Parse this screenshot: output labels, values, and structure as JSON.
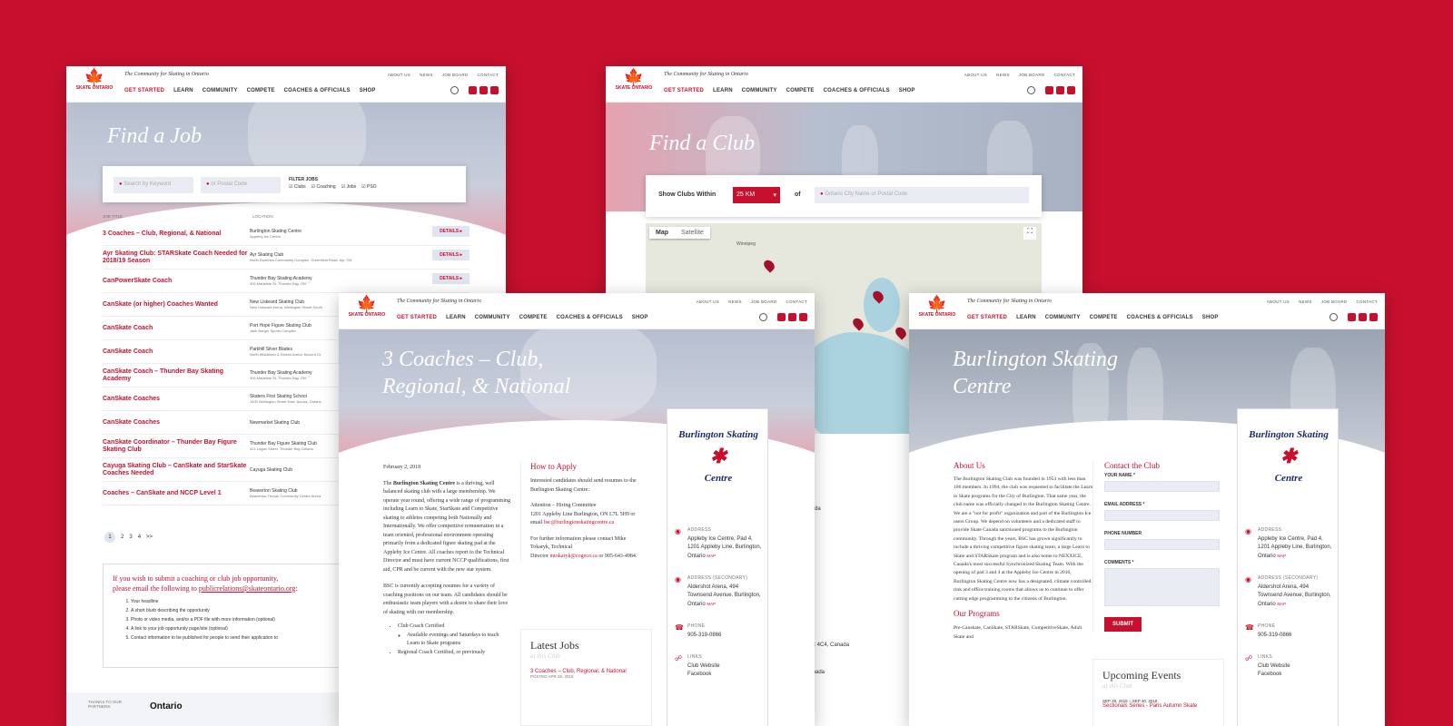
{
  "common": {
    "tagline": "The Community for Skating in Ontario",
    "logo_text": "SKATE ONTARIO",
    "logo_sub": "SKATE CANADA",
    "util_links": [
      "ABOUT US",
      "NEWS",
      "JOB BOARD",
      "CONTACT"
    ],
    "nav": [
      "GET STARTED",
      "LEARN",
      "COMMUNITY",
      "COMPETE",
      "COACHES & OFFICIALS",
      "SHOP"
    ]
  },
  "jobs_page": {
    "title": "Find a Job",
    "search_placeholder": "Search by Keyword",
    "postal_placeholder": "or Postal Code",
    "filter_label": "FILTER JOBS",
    "filters": [
      "Clubs",
      "Coaching",
      "Jobs",
      "PSO"
    ],
    "col_title": "JOB TITLE",
    "col_location": "LOCATION",
    "details_label": "DETAILS",
    "jobs": [
      {
        "title": "3 Coaches – Club, Regional, & National",
        "loc": "Burlington Skating Centre",
        "sub": "Appleby Ice Centre"
      },
      {
        "title": "Ayr Skating Club: STARSkate Coach Needed for 2018/19 Season",
        "loc": "Ayr Skating Club",
        "sub": "North Dumfries Community Complex, Greenfield Road, Ayr, ON"
      },
      {
        "title": "CanPowerSkate Coach",
        "loc": "Thunder Bay Skating Academy",
        "sub": "300 Madeline St, Thunder Bay, ON"
      },
      {
        "title": "CanSkate (or higher) Coaches Wanted",
        "loc": "New Liskeard Skating Club",
        "sub": "New Liskeard Arena, Wellington Street South"
      },
      {
        "title": "CanSkate Coach",
        "loc": "Port Hope Figure Skating Club",
        "sub": "Jack Burger Sports Complex"
      },
      {
        "title": "CanSkate Coach",
        "loc": "Parkhill Silver Blades",
        "sub": "North Middlesex & District Arena, Mccord Dr"
      },
      {
        "title": "CanSkate Coach – Thunder Bay Skating Academy",
        "loc": "Thunder Bay Skating Academy",
        "sub": "300 Madeline St, Thunder Bay, ON"
      },
      {
        "title": "CanSkate Coaches",
        "loc": "Skaters First Skating School",
        "sub": "1400 Wellington Street East, Aurora, Ontario"
      },
      {
        "title": "CanSkate Coaches",
        "loc": "Newmarket Skating Club",
        "sub": ""
      },
      {
        "title": "CanSkate Coordinator – Thunder Bay Figure Skating Club",
        "loc": "Thunder Bay Figure Skating Club",
        "sub": "421 Logan Street, Thunder Bay Ontario"
      },
      {
        "title": "Cayuga Skating Club – CanSkate and StarSkate Coaches Needed",
        "loc": "Cayuga Skating Club",
        "sub": ""
      },
      {
        "title": "Coaches – CanSkate and NCCP Level 1",
        "loc": "Beaverton Skating Club",
        "sub": "Beaverton-Thorah Community Centre Arena"
      }
    ],
    "pages": [
      "1",
      "2",
      "3",
      "4",
      ">>"
    ],
    "submit_heading_a": "If you wish to submit a coaching or club job opportunity,",
    "submit_heading_b": "please email the following to",
    "submit_email": "publicrelations@skateontario.org",
    "submit_list": [
      "Your headline",
      "A short blurb describing the opportunity",
      "Photo or video media, and/or a PDF file with more information (optional)",
      "A link to your job opportunity page/site (optional)",
      "Contact information to be published for people to send their application to"
    ],
    "partners_label": "THANKS TO OUR PARTNERS:",
    "partner_1": "Ontario"
  },
  "club_page": {
    "title": "Find a Club",
    "show_within": "Show Clubs Within",
    "distance": "25 KM",
    "of": "of",
    "location_placeholder": "Ontario City Name or Postal Code",
    "map_tab": "Map",
    "satellite_tab": "Satellite",
    "map_label": "Winnipeg",
    "list_fragments": [
      "anada",
      "L4C 4C4, Canada",
      "Canada"
    ]
  },
  "job_detail": {
    "title_1": "3 Coaches – Club,",
    "title_2": "Regional, & National",
    "date": "February 2, 2018",
    "body_a_pre": "The ",
    "body_a_bold": "Burlington Skating Centre",
    "body_a_rest": " is a thriving, well balanced skating club with a large membership. We operate year round, offering a wide range of programming including Learn to Skate, StarSkate and Competitive skating to athletes competing both Nationally and Internationally. We offer competitive remuneration in a team oriented, professional environment operating primarily from a dedicated figure skating pad at the Appleby Ice Centre. All coaches report to the Technical Director and must have current NCCP qualifications, first aid, CPR and be current with the new star system.",
    "body_b": "BSC is currently accepting resumes for a variety of coaching positions on our team. All candidates should be enthusiastic team players with a desire to share their love of skating with our membership.",
    "bullet_1": "Club Coach Certified",
    "sub_bullet_1": "Available evenings and Saturdays to teach Learn to Skate programs",
    "bullet_2": "Regional Coach Certified, or previously",
    "apply_heading": "How to Apply",
    "apply_1": "Interested candidates should send resumes to the Burlington Skating Centre:",
    "apply_2": "Attention – Hiring Committee",
    "apply_3": "1201 Appleby Line Burlington, ON L7L 5H9 or",
    "apply_4_pre": "email ",
    "apply_email": "bsc@burlingtonskatingcentre.ca",
    "apply_5": "For further information please contact Mike Tokaryk, Technical",
    "apply_6_pre": "Director ",
    "apply_email_2": "mtokaryk@cogeco.ca",
    "apply_6_post": " or 905-643-4984.",
    "latest_jobs": "Latest Jobs",
    "at_club": "at this Club",
    "latest_job_title": "3 Coaches – Club, Regional, & National",
    "latest_job_date": "POSTED APR 26, 2018"
  },
  "sidebar": {
    "club_name_1": "Burlington Skating",
    "club_name_2": "Centre",
    "address_label": "ADDRESS",
    "address": "Appleby Ice Centre, Pad 4, 1201 Appleby Line, Burlington, Ontario",
    "map_link": "MAP",
    "address2_label": "ADDRESS (SECONDARY)",
    "address2": "Aldershot Arena, 494 Townsend Avenue, Burlington, Ontario",
    "phone_label": "PHONE",
    "phone": "905-319-0866",
    "links_label": "LINKS",
    "link_1": "Club Website",
    "link_2": "Facebook"
  },
  "club_detail": {
    "title_1": "Burlington Skating",
    "title_2": "Centre",
    "about_heading": "About Us",
    "about_text": "The Burlington Skating Club was founded in 1953 with less than 100 members. In 1994, the club was requested to facilitate the Learn to Skate programs for the City of Burlington. That same year, the club name was officially changed to the Burlington Skating Centre. We are a \"not for profit\" organization and part of the Burlington Ice users Group. We depend on volunteers and a dedicated staff to provide Skate Canada sanctioned programs to the Burlington community. Through the years, BSC has grown significantly to include a thriving competitive figure skating team, a large Learn to Skate and STARSkate program and is also home to NEXXICE, Canada's most successful Synchronized Skating Team. With the opening of pad 3 and 4 at the Appleby Ice Centre in 2010, Burlington Skating Centre now has a designated, climate controlled rink and office training rooms that allows us to continue to offer cutting edge programming to the citizens of Burlington.",
    "programs_heading": "Our  Programs",
    "programs_text": "Pre-Canskate, CanSkate, STARSkate, CompetitiveSkate, Adult Skate and",
    "contact_heading": "Contact the Club",
    "f_name": "YOUR NAME *",
    "f_email": "EMAIL ADDRESS *",
    "f_phone": "PHONE NUMBER",
    "f_comments": "COMMENTS *",
    "submit": "SUBMIT",
    "events_heading": "Upcoming Events",
    "events_at": "at this Club",
    "event_date": "SEP 28, 2018 – SEP 30, 2018",
    "event_title": "Sectionals Series - Paris Autumn Skate"
  },
  "colors": {
    "brand_red": "#c8102e",
    "nav_text": "#333333",
    "field_bg": "#e9edf3"
  }
}
